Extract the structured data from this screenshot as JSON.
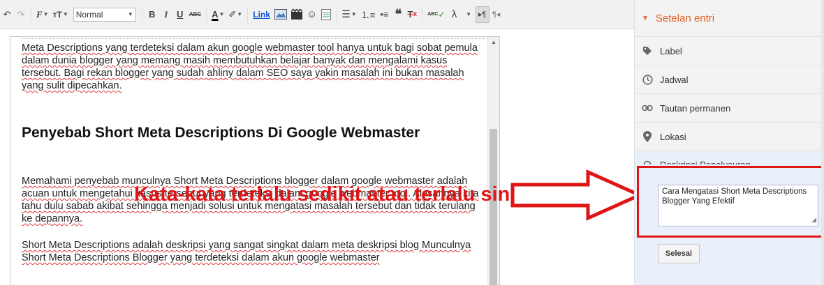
{
  "toolbar": {
    "font_style_value": "Normal",
    "bold_label": "B",
    "italic_label": "I",
    "underline_label": "U",
    "strike_label": "ABC",
    "text_color_label": "A",
    "link_label": "Link",
    "spell_label": "ABC"
  },
  "editor": {
    "para1": "Meta Descriptions yang terdeteksi dalam akun google webmaster tool hanya untuk bagi sobat pemula dalam dunia blogger yang memang masih membutuhkan belajar banyak dan mengalami kasus tersebut. Bagi rekan blogger yang sudah ahliny dalam SEO saya yakin masalah ini bukan masalah yang sulit dipecahkan.",
    "heading": "Penyebab  Short Meta Descriptions Di Google Webmaster",
    "para2": "Memahami penyebab munculnya Short Meta Descriptions blogger dalam google webmaster adalah acuan untuk mengetahui kasus tersebut yang terdeteksi dalam google webmaster tool. Alasannya kita tahu dulu sabab akibat sehingga  menjadi solusi untuk mengatasi masalah tersebut dan tidak terulang ke depannya.",
    "para3": "Short Meta Descriptions adalah deskripsi yang sangat singkat dalam meta deskripsi blog Munculnya Short Meta Descriptions Blogger yang terdeteksi dalam akun google webmaster"
  },
  "annotation": {
    "text": "Kata-kata terlalu sedikit atau terlalu singkat",
    "color": "#e01515"
  },
  "sidebar": {
    "title": "Setelan entri",
    "items": [
      {
        "label": "Label",
        "icon": "tag-icon"
      },
      {
        "label": "Jadwal",
        "icon": "clock-icon"
      },
      {
        "label": "Tautan permanen",
        "icon": "link-icon"
      },
      {
        "label": "Lokasi",
        "icon": "location-pin-icon"
      },
      {
        "label": "Deskripsi Penelusuran",
        "icon": "search-description-icon"
      }
    ],
    "search_description_value": "Cara Mengatasi Short Meta Descriptions Blogger Yang Efektif",
    "done_label": "Selesai"
  },
  "colors": {
    "accent": "#e0642c",
    "highlight": "#e01515",
    "panel": "#f3f3f3"
  }
}
